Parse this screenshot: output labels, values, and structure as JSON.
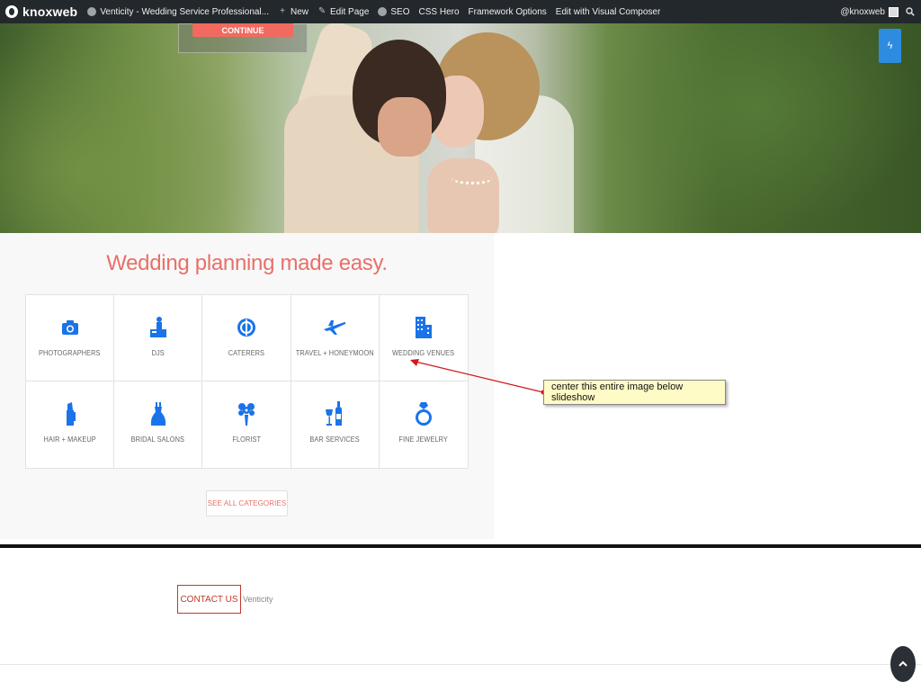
{
  "adminbar": {
    "brand": "knoxweb",
    "site_title": "Venticity - Wedding Service Professional...",
    "new_label": "New",
    "edit_page_label": "Edit Page",
    "seo_label": "SEO",
    "css_hero_label": "CSS Hero",
    "framework_label": "Framework Options",
    "visual_composer_label": "Edit with Visual Composer",
    "user_label": "@knoxweb"
  },
  "hero": {
    "continue_label": "CONTINUE"
  },
  "categories": {
    "title": "Wedding planning made easy.",
    "items": [
      {
        "label": "PHOTOGRAPHERS",
        "icon": "camera-icon"
      },
      {
        "label": "DJs",
        "icon": "dj-icon"
      },
      {
        "label": "CATERERS",
        "icon": "plate-icon"
      },
      {
        "label": "TRAVEL + HONEYMOON",
        "icon": "airplane-icon"
      },
      {
        "label": "WEDDING VENUES",
        "icon": "building-icon"
      },
      {
        "label": "HAIR + MAKEUP",
        "icon": "makeup-icon"
      },
      {
        "label": "BRIDAL SALONS",
        "icon": "dress-icon"
      },
      {
        "label": "FLORIST",
        "icon": "bouquet-icon"
      },
      {
        "label": "BAR SERVICES",
        "icon": "wine-icon"
      },
      {
        "label": "FINE JEWELRY",
        "icon": "ring-icon"
      }
    ],
    "see_all_label": "SEE ALL CATEGORIES",
    "icon_color": "#1a73e8",
    "accent_color": "#e8706a"
  },
  "annotation": {
    "text": "center this entire image below slideshow"
  },
  "footer": {
    "contact_label": "CONTACT US",
    "brand": "Venticity"
  }
}
